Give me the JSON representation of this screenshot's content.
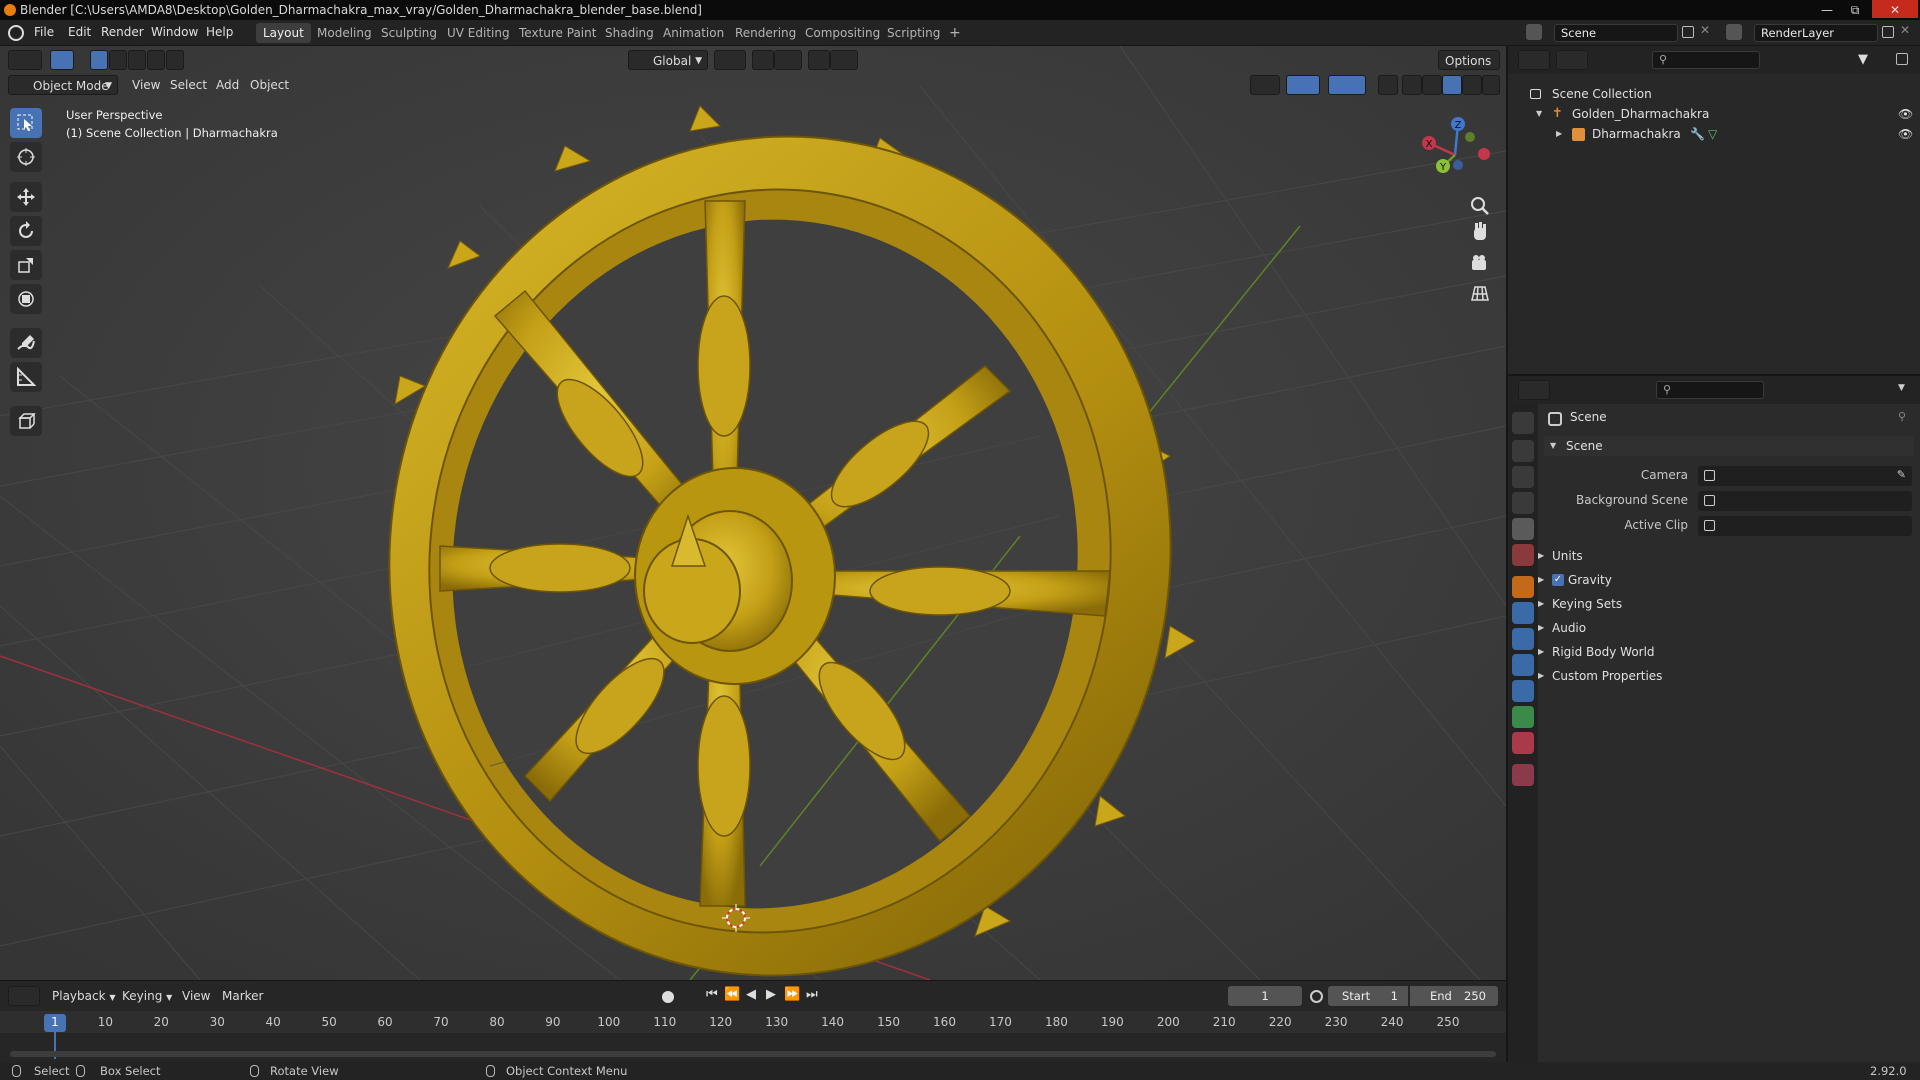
{
  "window": {
    "title": "Blender [C:\\Users\\AMDA8\\Desktop\\Golden_Dharmachakra_max_vray/Golden_Dharmachakra_blender_base.blend]"
  },
  "menu": {
    "items": [
      "File",
      "Edit",
      "Render",
      "Window",
      "Help"
    ]
  },
  "workspaces": {
    "tabs": [
      "Layout",
      "Modeling",
      "Sculpting",
      "UV Editing",
      "Texture Paint",
      "Shading",
      "Animation",
      "Rendering",
      "Compositing",
      "Scripting"
    ],
    "active": "Layout",
    "add": "+"
  },
  "scene_field": "Scene",
  "renderlayer_field": "RenderLayer",
  "viewport": {
    "transform_orientation": "Global",
    "options_label": "Options",
    "mode": "Object Mode",
    "header_menus": [
      "View",
      "Select",
      "Add",
      "Object"
    ],
    "overlay_title": "User Perspective",
    "overlay_subtitle": "(1) Scene Collection | Dharmachakra",
    "gizmo_axes": {
      "x": "X",
      "y": "Y",
      "z": "Z"
    }
  },
  "timeline": {
    "menus": [
      "Playback",
      "Keying",
      "View",
      "Marker"
    ],
    "current_frame": "1",
    "start_label": "Start",
    "start_value": "1",
    "end_label": "End",
    "end_value": "250",
    "ticks": [
      "1",
      "10",
      "20",
      "30",
      "40",
      "50",
      "60",
      "70",
      "80",
      "90",
      "100",
      "110",
      "120",
      "130",
      "140",
      "150",
      "160",
      "170",
      "180",
      "190",
      "200",
      "210",
      "220",
      "230",
      "240",
      "250"
    ]
  },
  "statusbar": {
    "select": "Select",
    "box_select": "Box Select",
    "rotate_view": "Rotate View",
    "context_menu": "Object Context Menu",
    "version": "2.92.0"
  },
  "outliner": {
    "root": "Scene Collection",
    "collection": "Golden_Dharmachakra",
    "object": "Dharmachakra"
  },
  "properties": {
    "context_title": "Scene",
    "panel_title": "Scene",
    "camera_label": "Camera",
    "background_label": "Background Scene",
    "active_clip_label": "Active Clip",
    "subpanels": [
      "Units",
      "Gravity",
      "Keying Sets",
      "Audio",
      "Rigid Body World",
      "Custom Properties"
    ],
    "gravity_checked": true
  },
  "colors": {
    "accent": "#4772b3",
    "gold": "#c9a61a",
    "x_axis": "#c2374a",
    "y_axis": "#6e9a2c",
    "z_axis": "#3f78cc"
  }
}
